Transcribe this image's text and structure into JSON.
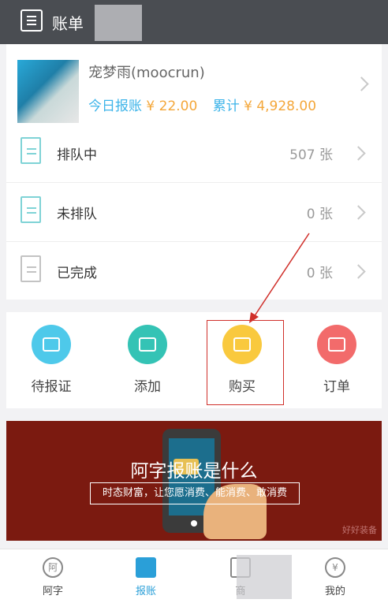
{
  "header": {
    "title": "账单"
  },
  "user": {
    "name": "宠梦雨(moocrun)",
    "today_label": "今日报账",
    "today_value": "¥ 22.00",
    "total_label": "累计",
    "total_value": "¥ 4,928.00"
  },
  "status_list": [
    {
      "label": "排队中",
      "count": "507 张"
    },
    {
      "label": "未排队",
      "count": "0 张"
    },
    {
      "label": "已完成",
      "count": "0 张"
    }
  ],
  "actions": [
    {
      "label": "待报证",
      "color": "#4ec9ea",
      "icon": "ticket-icon"
    },
    {
      "label": "添加",
      "color": "#34c3b5",
      "icon": "ticket-add-icon"
    },
    {
      "label": "购买",
      "color": "#f9c93e",
      "icon": "ticket-buy-icon"
    },
    {
      "label": "订单",
      "color": "#f26b6b",
      "icon": "order-icon"
    }
  ],
  "banner": {
    "title": "阿字报账是什么",
    "subtitle": "时态财富，让您愿消费、能消费、敢消费",
    "watermark": "好好装备"
  },
  "bottom_nav": [
    {
      "label": "阿字",
      "icon_text": "阿"
    },
    {
      "label": "报账",
      "icon_text": ""
    },
    {
      "label": "商",
      "icon_text": ""
    },
    {
      "label": "我的",
      "icon_text": "¥"
    }
  ],
  "colors": {
    "accent": "#2a9fd8",
    "amount": "#f4a73a",
    "highlight": "#d0302b"
  }
}
